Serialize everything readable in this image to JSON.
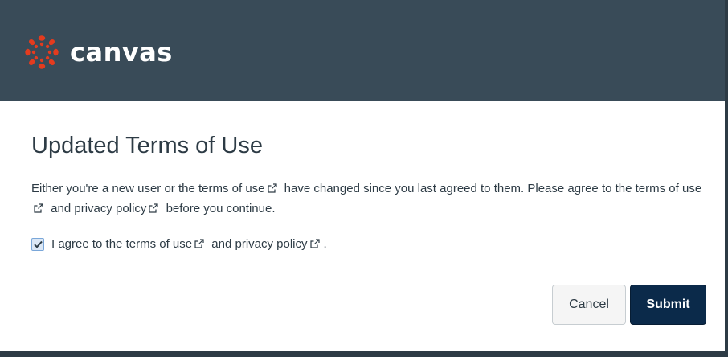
{
  "header": {
    "brand_name": "canvas",
    "logo_icon": "canvas-logo-icon",
    "background_color": "#394b58",
    "logo_color": "#e43b1e"
  },
  "dialog": {
    "title": "Updated Terms of Use",
    "message": {
      "part1": "Either you're a new user or the ",
      "terms_link": "terms of use",
      "part2": " have changed since you last agreed to them. Please agree to the ",
      "terms_link_2": "terms of use",
      "part3": " and ",
      "privacy_link": "privacy policy",
      "part4": " before you continue."
    },
    "agreement": {
      "checked": true,
      "prefix": "I agree to the ",
      "terms_link": "terms of use",
      "middle": " and ",
      "privacy_link": "privacy policy",
      "suffix": "."
    },
    "buttons": {
      "cancel_label": "Cancel",
      "submit_label": "Submit"
    },
    "external_link_icon": "external-link-icon",
    "submit_color": "#0b2a4a"
  }
}
